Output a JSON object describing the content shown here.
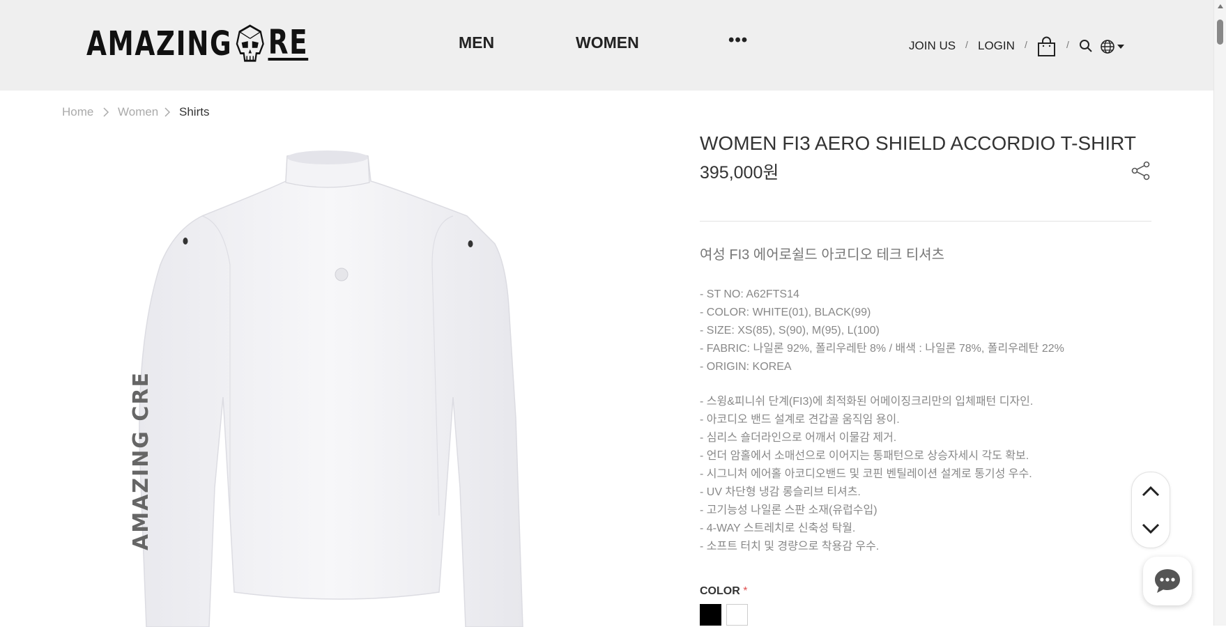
{
  "brand": {
    "logo_left": "AMAZING",
    "logo_right": "RE",
    "logo_alt_letter": "C"
  },
  "nav": {
    "men": "MEN",
    "women": "WOMEN",
    "more": "•••"
  },
  "utility": {
    "join": "JOIN US",
    "login": "LOGIN",
    "separator": "/"
  },
  "breadcrumb": [
    "Home",
    "Women",
    "Shirts"
  ],
  "product": {
    "title": "WOMEN FI3 AERO SHIELD ACCORDIO T-SHIRT",
    "price": "395,000원",
    "subtitle": "여성 FI3 에어로쉴드 아코디오 테크 티셔츠",
    "specs": [
      "- ST NO: A62FTS14",
      "- COLOR: WHITE(01), BLACK(99)",
      "- SIZE: XS(85), S(90), M(95), L(100)",
      "- FABRIC: 나일론 92%, 폴리우레탄 8% / 배색 : 나일론 78%, 폴리우레탄 22%",
      "- ORIGIN: KOREA"
    ],
    "features": [
      "- 스윙&피니쉬 단계(FI3)에 최적화된 어메이징크리만의 입체패턴 디자인.",
      "- 아코디오 밴드 설계로 견갑골 움직임 용이.",
      "- 심리스 숄더라인으로 어깨서 이물감 제거.",
      "- 언더 암홀에서 소매선으로 이어지는 통패턴으로 상승자세시 각도 확보.",
      "- 시그니처 에어홀 아코디오밴드 및 코핀 벤틸레이션 설계로 통기성 우수.",
      "- UV 차단형 냉감 롱슬리브 티셔츠.",
      "- 고기능성 나일론 스판 소재(유럽수입)",
      "- 4-WAY 스트레치로 신축성 탁월.",
      "- 소프트 터치 및 경량으로 착용감 우수."
    ],
    "color_label": "COLOR",
    "required_mark": "*",
    "sleeve_print": "AMAZING CRE"
  },
  "colors": {
    "header_bg": "#efefef",
    "swatch_black": "#000000",
    "swatch_white": "#ffffff",
    "required": "#e05050"
  },
  "icons": [
    "skull-logo-icon",
    "shopping-bag-icon",
    "search-icon",
    "globe-icon",
    "caret-down-icon",
    "share-icon",
    "chevron-right-icon",
    "chevron-up-icon",
    "chevron-down-icon",
    "chat-icon"
  ]
}
